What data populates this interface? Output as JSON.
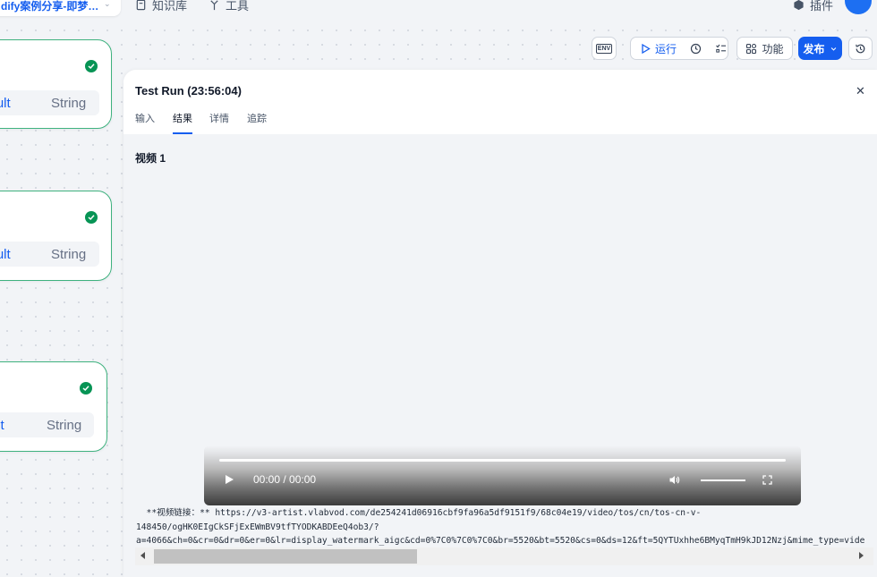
{
  "topbar": {
    "app_name": "dify案例分享-即梦…",
    "nav": [
      {
        "label": "知识库",
        "icon": "book-icon"
      },
      {
        "label": "工具",
        "icon": "tool-icon"
      },
      {
        "label": "插件",
        "icon": "cube-icon"
      }
    ]
  },
  "nodes": [
    {
      "var_name": "result",
      "var_type": "String",
      "status": "succeeded"
    },
    {
      "var_name": "result",
      "var_type": "String",
      "status": "succeeded"
    },
    {
      "var_name": "result",
      "var_type": "String",
      "status": "succeeded"
    }
  ],
  "toolbar": {
    "env_label": "ENV",
    "run_label": "运行",
    "features_label": "功能",
    "publish_label": "发布"
  },
  "panel": {
    "title": "Test Run (23:56:04)",
    "tabs": [
      "输入",
      "结果",
      "详情",
      "追踪"
    ],
    "active_tab": "结果",
    "section_title": "视频 1",
    "video": {
      "time": "00:00 / 00:00"
    },
    "link_lines": [
      "  **视频链接：** https://v3-artist.vlabvod.com/de254241d06916cbf9fa96a5df9151f9/68c04e19/video/tos/cn/tos-cn-v-",
      "148450/ogHK0EIgCkSFjExEWmBV9tfTYODKABDEeQ4ob3/?",
      "a=4066&ch=0&cr=0&dr=0&er=0&lr=display_watermark_aigc&cd=0%7C0%7C0%7C0&br=5520&bt=5520&cs=0&ds=12&ft=5QYTUxhhe6BMyqTmH9kJD12Nzj&mime_type=vide"
    ]
  },
  "colors": {
    "accent": "#155eef",
    "success": "#079455",
    "node_border": "#3fb27f"
  }
}
